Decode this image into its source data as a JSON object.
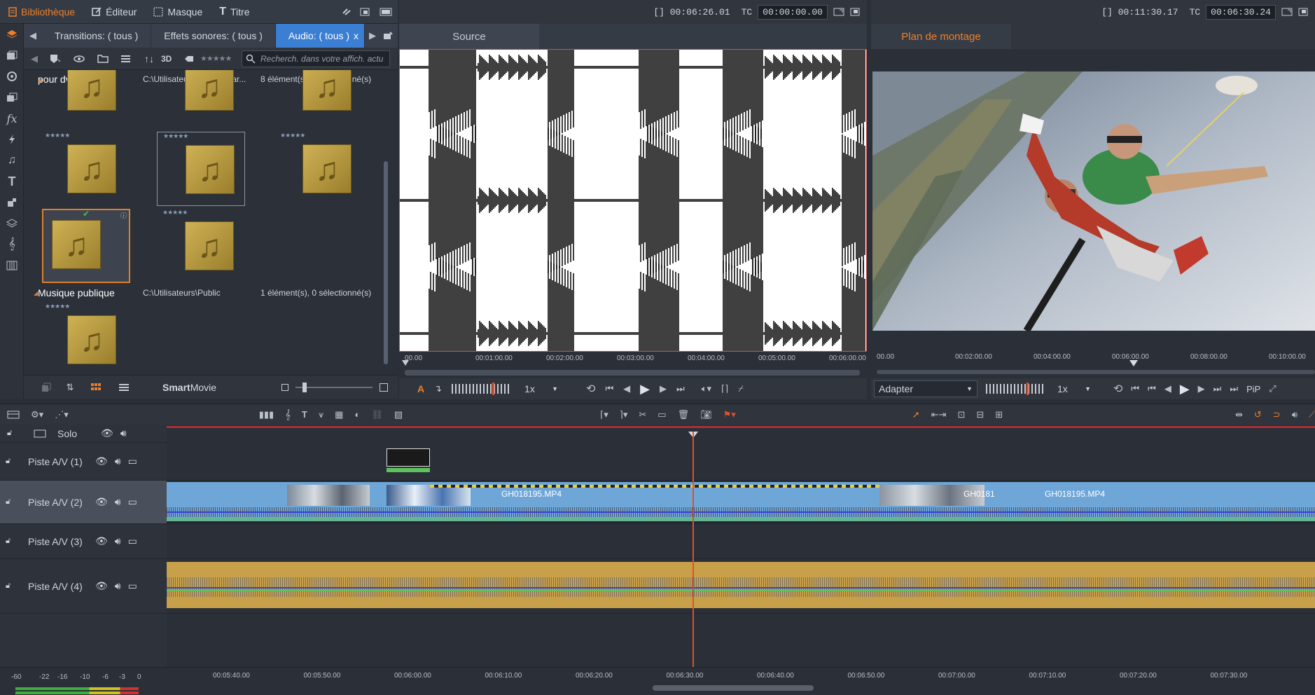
{
  "top_tabs": [
    {
      "label": "Bibliothèque",
      "icon": "library-icon"
    },
    {
      "label": "Éditeur",
      "icon": "editor-icon"
    },
    {
      "label": "Masque",
      "icon": "mask-icon"
    },
    {
      "label": "Titre",
      "icon": "title-icon"
    }
  ],
  "library": {
    "tabs": [
      "Transitions: ( tous )",
      "Effets sonores: ( tous )",
      "Audio: ( tous )"
    ],
    "active_tab_close": "x",
    "toolbar_3d": "3D",
    "search_placeholder": "Recherch. dans votre affich. actu",
    "groups": [
      {
        "name": "pour dvd",
        "path": "C:\\Utilisateurs\\patrice mar...",
        "count": "8 élément(s), 1 sélectionné(s)"
      },
      {
        "name": "Musique publique",
        "path": "C:\\Utilisateurs\\Public",
        "count": "1 élément(s), 0 sélectionné(s)"
      }
    ],
    "stars": "★★★★★",
    "note_glyph": "♫",
    "bottom_label_bold": "Smart",
    "bottom_label": "Movie"
  },
  "source": {
    "tab": "Source",
    "duration": "[] 00:06:26.01",
    "tc_label": "TC",
    "tc_value": "00:00:00.00",
    "ruler": [
      "00.00",
      "00:01:00.00",
      "00:02:00.00",
      "00:03:00.00",
      "00:04:00.00",
      "00:05:00.00",
      "00:06:00.00"
    ],
    "speed": "1x"
  },
  "preview": {
    "tab": "Plan de montage",
    "duration": "[] 00:11:30.17",
    "tc_label": "TC",
    "tc_value": "00:06:30.24",
    "ruler": [
      "00.00",
      "00:02:00.00",
      "00:04:00.00",
      "00:06:00.00",
      "00:08:00.00",
      "00:10:00.00"
    ],
    "fit": "Adapter",
    "speed": "1x",
    "pip": "PiP"
  },
  "timeline": {
    "solo": "Solo",
    "tracks": [
      "Piste A/V (1)",
      "Piste A/V (2)",
      "Piste A/V (3)",
      "Piste A/V (4)"
    ],
    "clip_labels": [
      "GH018195.MP4",
      "GH0181",
      "GH018195.MP4"
    ],
    "ruler": [
      "00:05:40.00",
      "00:05:50.00",
      "00:06:00.00",
      "00:06:10.00",
      "00:06:20.00",
      "00:06:30.00",
      "00:06:40.00",
      "00:06:50.00",
      "00:07:00.00",
      "00:07:10.00",
      "00:07:20.00",
      "00:07:30.00"
    ],
    "meter_labels": [
      "-60",
      "-22",
      "-16",
      "-10",
      "-6",
      "-3",
      "0"
    ]
  },
  "colors": {
    "accent": "#ee7f2a",
    "tab_active": "#3a7fd4",
    "clip_blue": "#6fa6d8",
    "audio_gold": "#c8a04a",
    "playhead": "#e0502a"
  }
}
